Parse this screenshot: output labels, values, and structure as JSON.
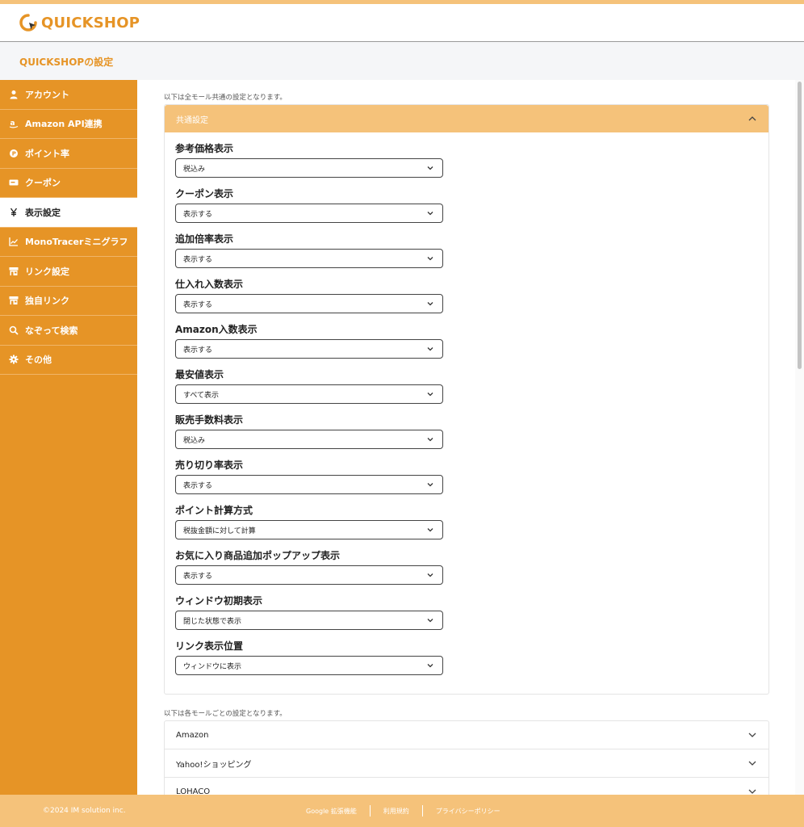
{
  "app": {
    "brand": "QUICKSHOP",
    "page_title": "QUICKSHOPの設定"
  },
  "sidebar": {
    "items": [
      {
        "label": "アカウント",
        "icon": "user-icon"
      },
      {
        "label": "Amazon API連携",
        "icon": "amazon-icon"
      },
      {
        "label": "ポイント率",
        "icon": "point-icon"
      },
      {
        "label": "クーポン",
        "icon": "coupon-icon"
      },
      {
        "label": "表示設定",
        "icon": "yen-icon",
        "active": true
      },
      {
        "label": "MonoTracerミニグラフ",
        "icon": "chart-icon"
      },
      {
        "label": "リンク設定",
        "icon": "store-icon"
      },
      {
        "label": "独自リンク",
        "icon": "store-icon"
      },
      {
        "label": "なぞって検索",
        "icon": "search-icon"
      },
      {
        "label": "その他",
        "icon": "gear-icon"
      }
    ]
  },
  "common": {
    "note": "以下は全モール共通の設定となります。",
    "section_title": "共通設定",
    "fields": [
      {
        "label": "参考価格表示",
        "value": "税込み"
      },
      {
        "label": "クーポン表示",
        "value": "表示する"
      },
      {
        "label": "追加倍率表示",
        "value": "表示する"
      },
      {
        "label": "仕入れ入数表示",
        "value": "表示する"
      },
      {
        "label": "Amazon入数表示",
        "value": "表示する"
      },
      {
        "label": "最安値表示",
        "value": "すべて表示"
      },
      {
        "label": "販売手数料表示",
        "value": "税込み"
      },
      {
        "label": "売り切り率表示",
        "value": "表示する"
      },
      {
        "label": "ポイント計算方式",
        "value": "税抜金額に対して計算"
      },
      {
        "label": "お気に入り商品追加ポップアップ表示",
        "value": "表示する"
      },
      {
        "label": "ウィンドウ初期表示",
        "value": "閉じた状態で表示"
      },
      {
        "label": "リンク表示位置",
        "value": "ウィンドウに表示"
      }
    ]
  },
  "malls": {
    "note": "以下は各モールごとの設定となります。",
    "items": [
      "Amazon",
      "Yahoo!ショッピング",
      "LOHACO"
    ]
  },
  "footer": {
    "copyright": "©2024 IM solution inc.",
    "links": [
      "Google 拡張機能",
      "利用規約",
      "プライバシーポリシー"
    ]
  },
  "colors": {
    "accent": "#e69426",
    "accent_light": "#f5c27a"
  }
}
